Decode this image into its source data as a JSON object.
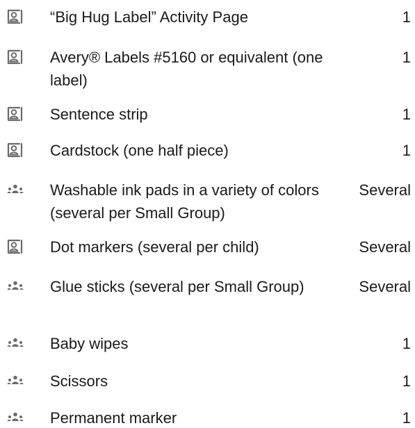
{
  "materials": [
    {
      "name": "“Big Hug Label” Activity Page",
      "quantity": "1",
      "icon": "child-icon"
    },
    {
      "name": "Avery® Labels #5160 or equivalent (one label)",
      "quantity": "1",
      "icon": "child-icon"
    },
    {
      "name": "Sentence strip",
      "quantity": "1",
      "icon": "child-icon"
    },
    {
      "name": "Cardstock (one half piece)",
      "quantity": "1",
      "icon": "child-icon"
    },
    {
      "name": "Washable ink pads in a variety of colors (several per Small Group)",
      "quantity": "Several",
      "icon": "group-icon"
    },
    {
      "name": "Dot markers (several per child)",
      "quantity": "Several",
      "icon": "child-icon"
    },
    {
      "name": "Glue sticks (several per Small Group)",
      "quantity": "Several",
      "icon": "group-icon"
    },
    {
      "name": "Baby wipes",
      "quantity": "1",
      "icon": "group-icon"
    },
    {
      "name": "Scissors",
      "quantity": "1",
      "icon": "group-icon"
    },
    {
      "name": "Permanent marker",
      "quantity": "1",
      "icon": "group-icon"
    }
  ],
  "colors": {
    "text": "#1a1a1a",
    "icon": "#6b6b6b"
  }
}
